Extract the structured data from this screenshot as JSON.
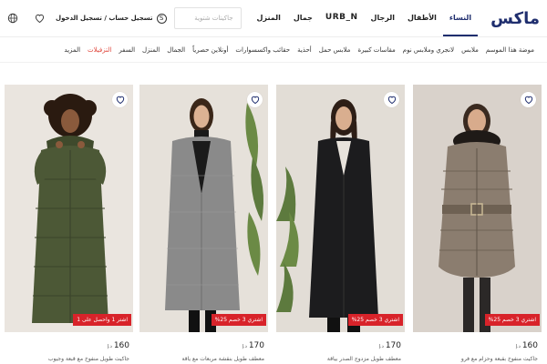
{
  "header": {
    "logo": "ماكس",
    "nav": [
      "النساء",
      "الأطفال",
      "الرجال",
      "URB_N",
      "جمال",
      "المنزل"
    ],
    "active_nav": 0,
    "search_placeholder": "جاكيتات شتوية",
    "account_symbol": "S",
    "account_text": "تسجيل حساب / تسجيل الدخول"
  },
  "categories": [
    "موضة هذا الموسم",
    "ملابس",
    "لانجري وملابس نوم",
    "مقاسات كبيرة",
    "ملابس حمل",
    "أحذية",
    "حقائب واكسسوارات",
    "أونلاين حصرياً",
    "الجمال",
    "المنزل",
    "السفر",
    "التزفيلات",
    "المزيد"
  ],
  "sale_category_index": 11,
  "products": [
    {
      "badge": "اشتري 3 خصم 25%",
      "price": "160",
      "currency": "د.إ",
      "name": "جاكيت منفوخ بقبعة وحزام مع فرو"
    },
    {
      "badge": "اشتري 3 خصم 25%",
      "price": "170",
      "currency": "د.إ",
      "name": "معطف طويل مزدوج الصدر بياقة"
    },
    {
      "badge": "اشتري 3 خصم 25%",
      "price": "170",
      "currency": "د.إ",
      "name": "معطف طويل بنقشة مربعات مع ياقة"
    },
    {
      "badge": "اشتر 1 واحصل على 1",
      "price": "160",
      "currency": "د.إ",
      "name": "جاكيت طويل منفوخ مع قبعة وجيوب"
    }
  ],
  "colors": {
    "brand": "#1f2e6e",
    "sale": "#e0453a",
    "badge": "#d8232a"
  }
}
